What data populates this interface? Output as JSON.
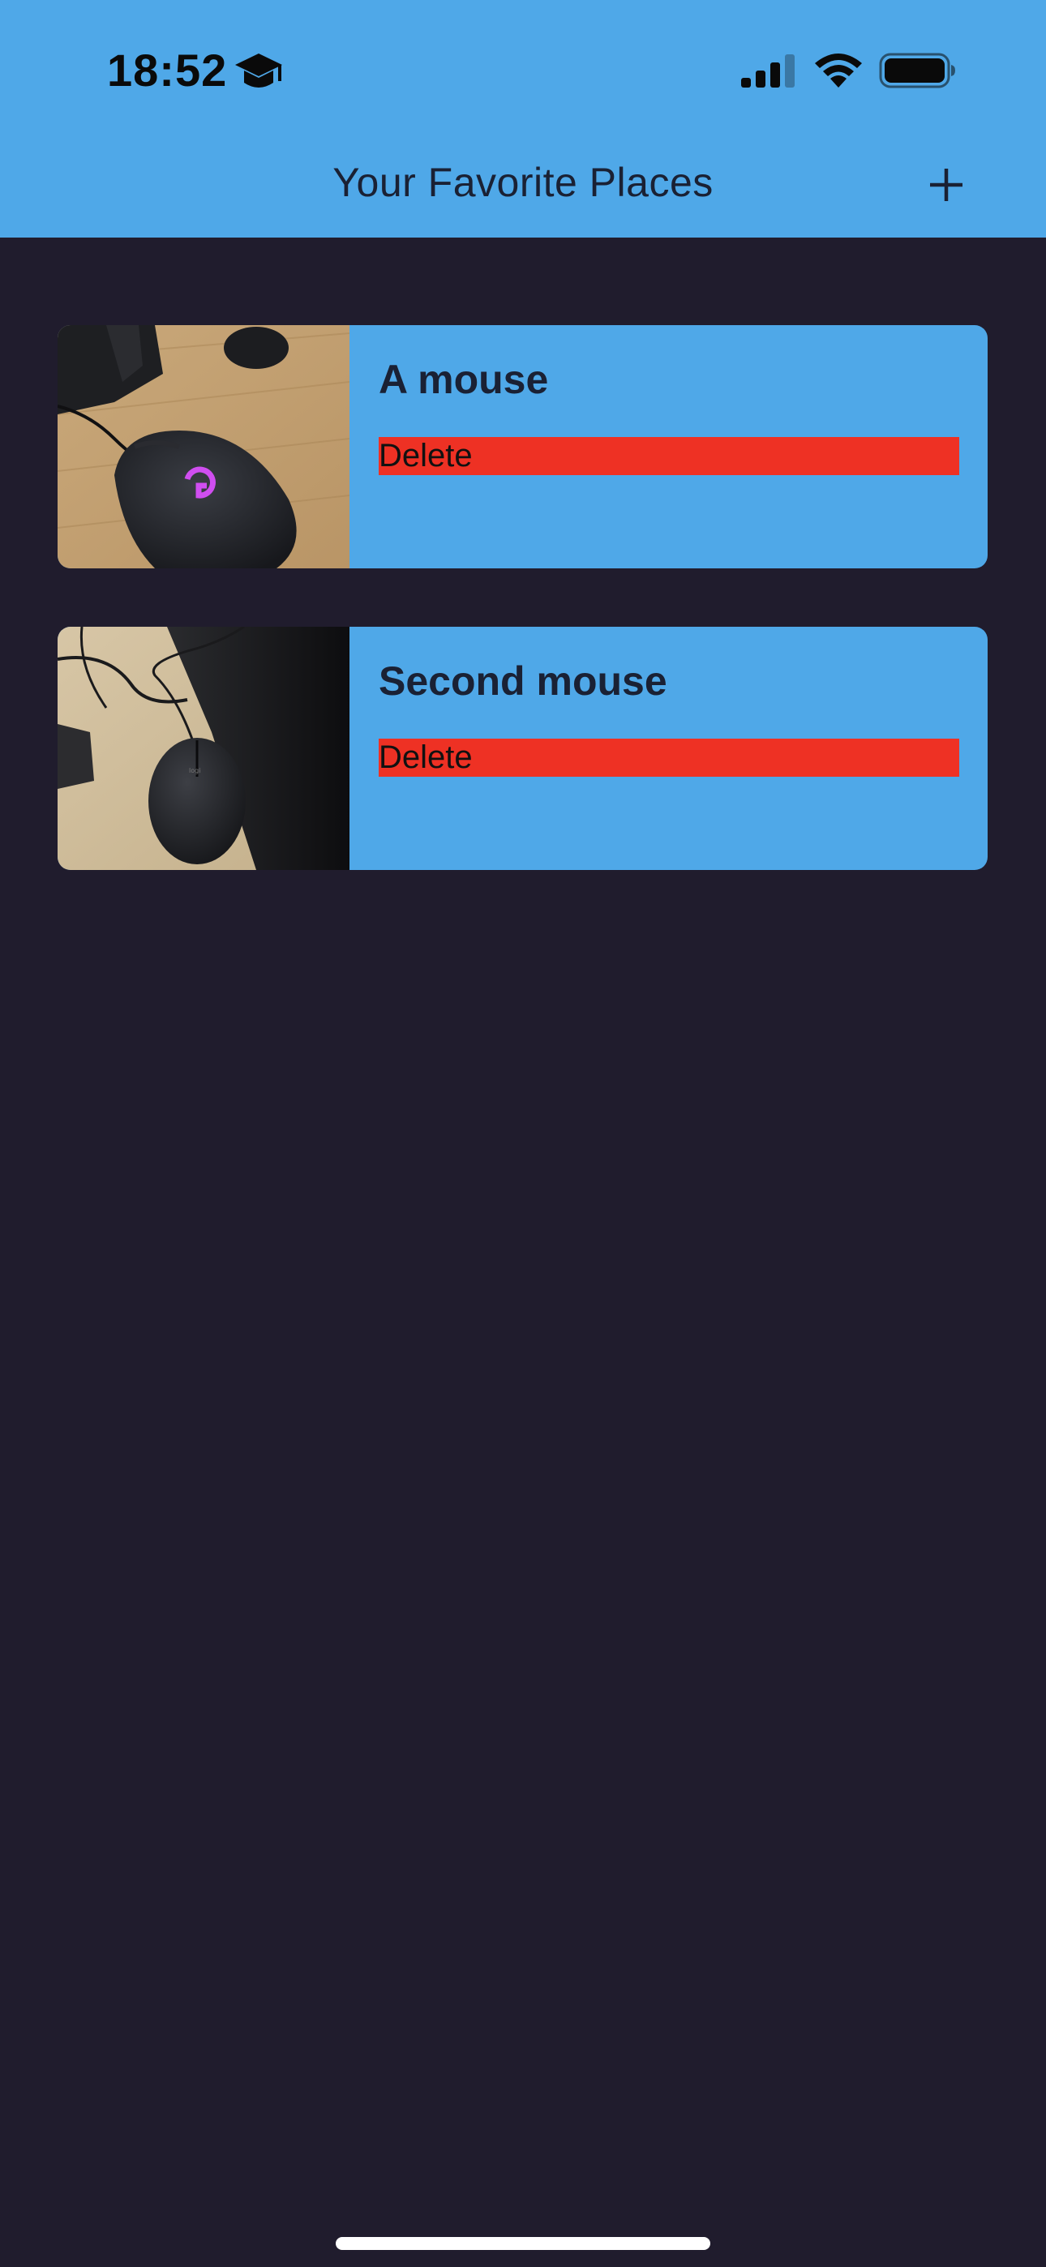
{
  "status_bar": {
    "time": "18:52",
    "icons": [
      "graduation-cap-icon",
      "cellular-signal-icon",
      "wifi-icon",
      "battery-icon"
    ]
  },
  "app_bar": {
    "title": "Your Favorite Places",
    "add_icon": "plus-icon",
    "background_color": "#4fa8e8"
  },
  "places": [
    {
      "title": "A mouse",
      "delete_label": "Delete",
      "image": "gaming-mouse-on-wooden-desk-photo"
    },
    {
      "title": "Second mouse",
      "delete_label": "Delete",
      "image": "black-mouse-on-desk-photo"
    }
  ],
  "colors": {
    "background": "#201c2d",
    "card": "#4fa8e8",
    "delete": "#ee3124",
    "text": "#1a2134"
  }
}
